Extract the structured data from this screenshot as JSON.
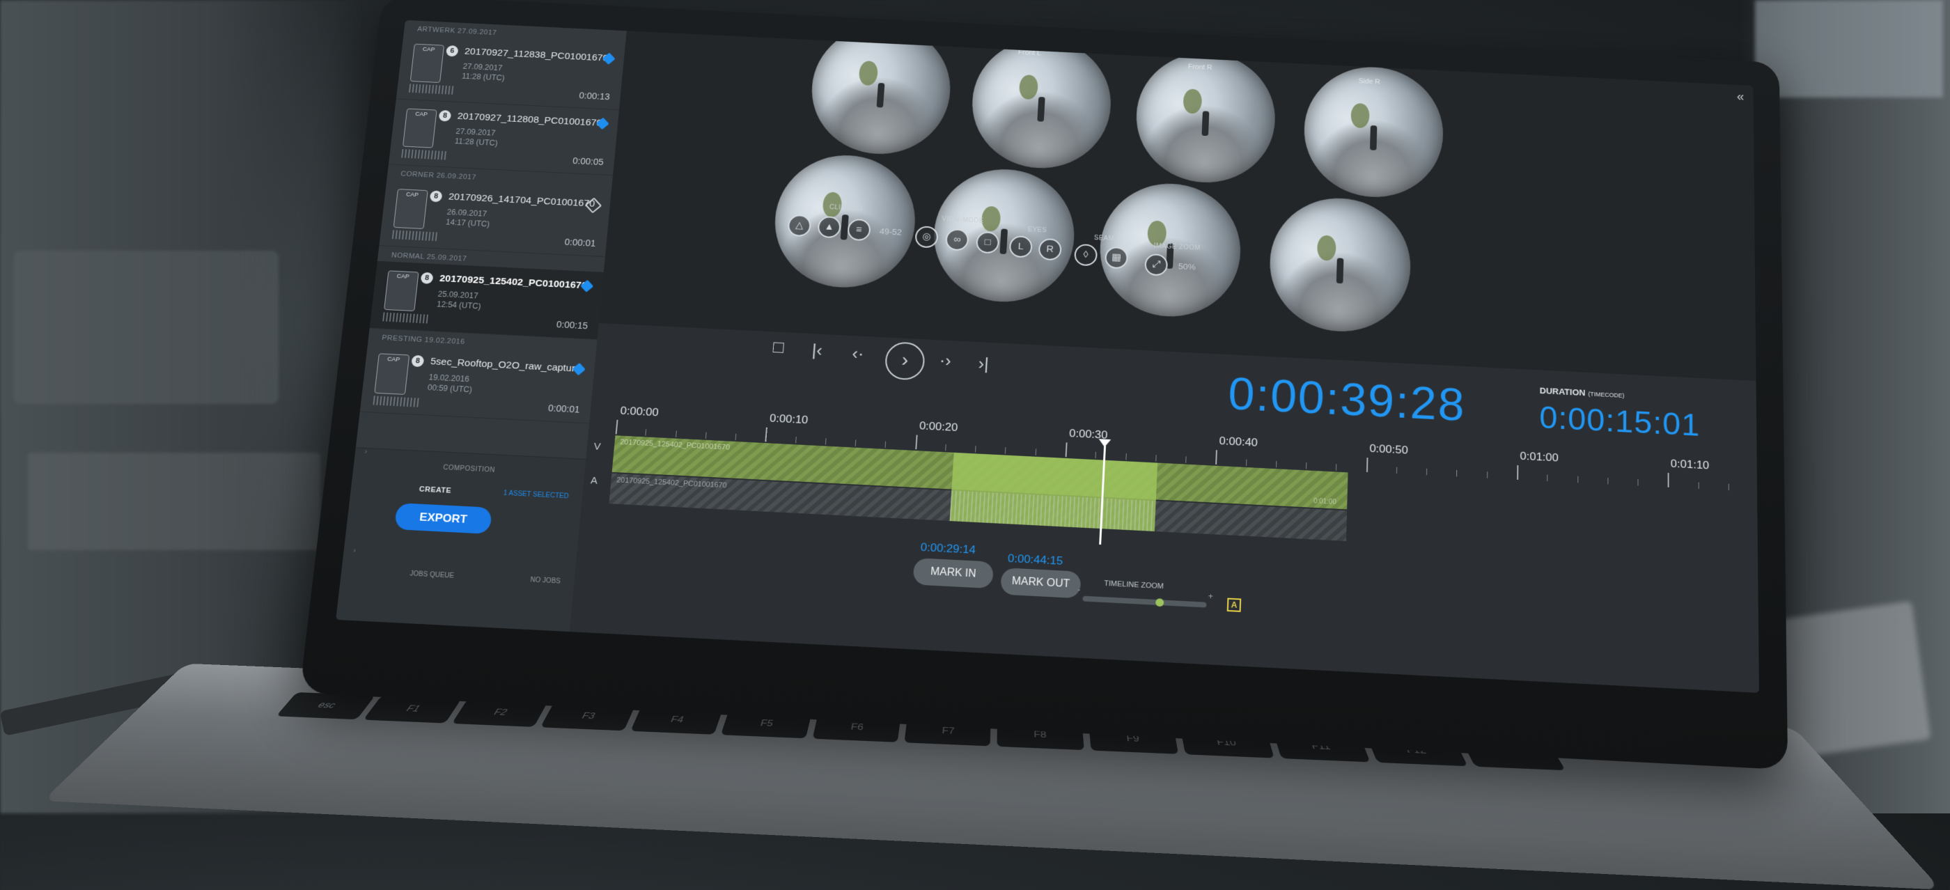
{
  "sidebar": {
    "groups": [
      {
        "label": "ARTWERK 27.09.2017",
        "clips": [
          {
            "index": "6",
            "thumb": "CAP",
            "name": "20170927_112838_PC01001670",
            "date": "27.09.2017",
            "time": "11:28 (UTC)",
            "duration": "0:00:13",
            "tag": "filled"
          },
          {
            "index": "8",
            "thumb": "CAP",
            "name": "20170927_112808_PC01001670",
            "date": "27.09.2017",
            "time": "11:28 (UTC)",
            "duration": "0:00:05",
            "tag": "filled"
          }
        ]
      },
      {
        "label": "CORNER 26.09.2017",
        "clips": [
          {
            "index": "8",
            "thumb": "CAP",
            "name": "20170926_141704_PC01001670",
            "date": "26.09.2017",
            "time": "14:17 (UTC)",
            "duration": "0:00:01",
            "tag": "outline"
          }
        ]
      },
      {
        "label": "NORMAL 25.09.2017",
        "clips": [
          {
            "index": "8",
            "thumb": "CAP",
            "name": "20170925_125402_PC01001670",
            "date": "25.09.2017",
            "time": "12:54 (UTC)",
            "duration": "0:00:15",
            "tag": "filled",
            "selected": true
          }
        ]
      },
      {
        "label": "PRESTING 19.02.2016",
        "clips": [
          {
            "index": "8",
            "thumb": "CAP",
            "name": "5sec_Rooftop_O2O_raw_capture",
            "date": "19.02.2016",
            "time": "00:59 (UTC)",
            "duration": "0:00:01",
            "tag": "filled"
          }
        ]
      }
    ],
    "composition_label": "COMPOSITION",
    "create_label": "CREATE",
    "asset_selected": "1 ASSET SELECTED",
    "export_label": "EXPORT",
    "jobs_queue_label": "JOBS QUEUE",
    "no_jobs_label": "NO JOBS"
  },
  "viewer": {
    "collapse_icon": "double-chevron-left-icon",
    "camera_labels": [
      "Front L",
      "Front R",
      "Side R"
    ],
    "tools": {
      "clipping_label": "CLIPPING",
      "clipping_value": "49-52",
      "view_mode_label": "VIEW-MODE",
      "eyes_label": "EYES",
      "seams_label": "SEAMS",
      "image_zoom_label": "IMAGE ZOOM",
      "image_zoom_value": "50%"
    }
  },
  "transport": {
    "current_timecode": "0:00:39:28",
    "duration_label": "DURATION",
    "duration_sublabel": "(TIMECODE)",
    "duration_value": "0:00:15:01"
  },
  "timeline": {
    "ticks": [
      "0:00:00",
      "0:00:10",
      "0:00:20",
      "0:00:30",
      "0:00:40",
      "0:00:50",
      "0:01:00",
      "0:01:10"
    ],
    "track_v_label": "V",
    "track_a_label": "A",
    "clip_name": "20170925_125402_PC01001670",
    "clip_end_tc": "0:01:00",
    "mark_in_tc": "0:00:29:14",
    "mark_out_tc": "0:00:44:15",
    "mark_in_label": "MARK IN",
    "mark_out_label": "MARK OUT",
    "timeline_zoom_label": "TIMELINE ZOOM",
    "zoom_minus": "-",
    "zoom_plus": "+",
    "audio_badge": "A"
  },
  "keyboard": {
    "keys": [
      "esc",
      "F1",
      "F2",
      "F3",
      "F4",
      "F5",
      "F6",
      "F7",
      "F8",
      "F9",
      "F10",
      "F11",
      "F12",
      ""
    ]
  }
}
